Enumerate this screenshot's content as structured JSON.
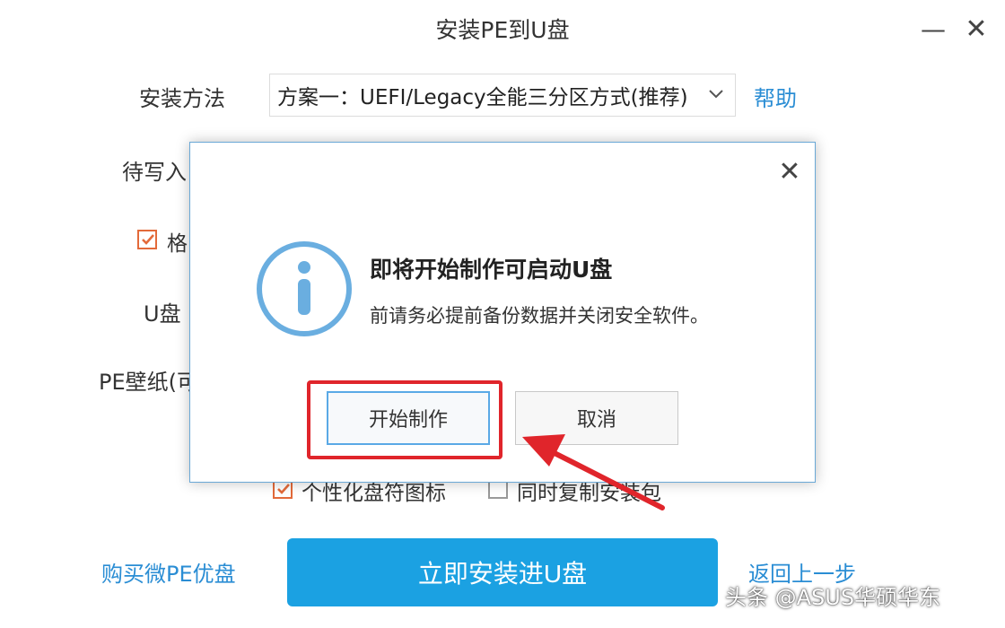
{
  "window": {
    "title": "安装PE到U盘",
    "minimize_glyph": "—",
    "close_glyph": "✕"
  },
  "form": {
    "method_label": "安装方法",
    "method_value": "方案一：UEFI/Legacy全能三分区方式(推荐)",
    "help_link": "帮助",
    "pending_label_partial": "待写入",
    "format_label_partial": "格",
    "u_label_partial": "U盘",
    "wallpaper_label_partial": "PE壁纸(可",
    "icon_checkbox_label": "个性化盘符图标",
    "copy_checkbox_label": "同时复制安装包"
  },
  "footer": {
    "buy_link": "购买微PE优盘",
    "install_button": "立即安装进U盘",
    "back_link": "返回上一步"
  },
  "dialog": {
    "close_glyph": "✕",
    "title": "即将开始制作可启动U盘",
    "message": "前请务必提前备份数据并关闭安全软件。",
    "start_button": "开始制作",
    "cancel_button": "取消"
  },
  "watermark": "头条 @ASUS华硕华东",
  "colors": {
    "accent": "#1ba1e2",
    "link": "#2a8dd4",
    "highlight": "#e0252b",
    "info_icon": "#6aaee0",
    "checkbox_tick": "#e36a3a"
  },
  "icons": [
    "minimize-icon",
    "close-icon",
    "chevron-down-icon",
    "checkmark-icon",
    "info-icon",
    "red-arrow-icon"
  ]
}
